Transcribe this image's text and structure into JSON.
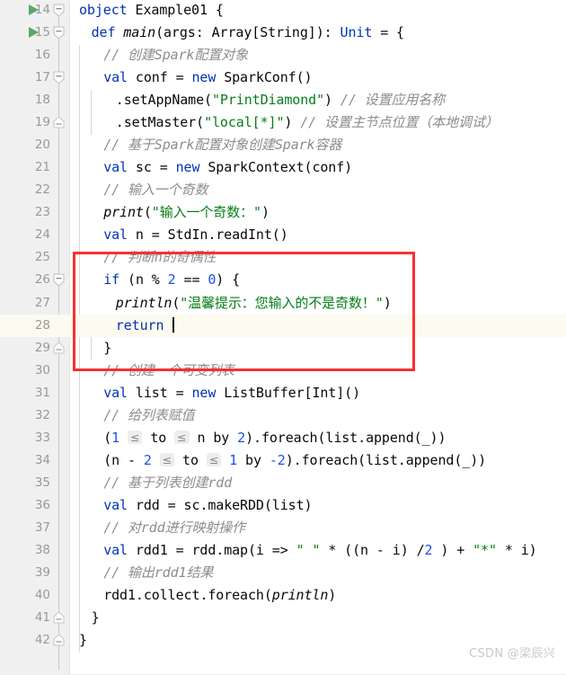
{
  "app": {
    "name": "IntelliJ IDEA Scala Editor",
    "watermark": "CSDN @梁辰兴",
    "colors": {
      "keyword": "#0033b3",
      "number": "#1750eb",
      "string": "#067d17",
      "comment": "#8c8c8c",
      "gutter_bg": "#f0f0f0",
      "current_line_bg": "#fdfaf0",
      "annotation_box": "#f93030",
      "run_arrow": "#59a869"
    }
  },
  "editor": {
    "first_line_number": 14,
    "current_line_number": 28,
    "annotation_box": {
      "type": "red-rectangle-highlight",
      "covers_lines": "25-29",
      "color": "#f93030"
    },
    "lines": [
      {
        "n": 14,
        "indent": 0,
        "run_arrow": true,
        "fold": "open",
        "text": "object Example01 {"
      },
      {
        "n": 15,
        "indent": 1,
        "run_arrow": true,
        "fold": "open",
        "text": "def main(args: Array[String]): Unit = {"
      },
      {
        "n": 16,
        "indent": 2,
        "run_arrow": false,
        "fold": "none",
        "text": "// 创建Spark配置对象"
      },
      {
        "n": 17,
        "indent": 2,
        "run_arrow": false,
        "fold": "open",
        "text": "val conf = new SparkConf()"
      },
      {
        "n": 18,
        "indent": 3,
        "run_arrow": false,
        "fold": "none",
        "text": ".setAppName(\"PrintDiamond\") // 设置应用名称"
      },
      {
        "n": 19,
        "indent": 3,
        "run_arrow": false,
        "fold": "close",
        "text": ".setMaster(\"local[*]\") // 设置主节点位置（本地调试）"
      },
      {
        "n": 20,
        "indent": 2,
        "run_arrow": false,
        "fold": "none",
        "text": "// 基于Spark配置对象创建Spark容器"
      },
      {
        "n": 21,
        "indent": 2,
        "run_arrow": false,
        "fold": "none",
        "text": "val sc = new SparkContext(conf)"
      },
      {
        "n": 22,
        "indent": 2,
        "run_arrow": false,
        "fold": "none",
        "text": "// 输入一个奇数"
      },
      {
        "n": 23,
        "indent": 2,
        "run_arrow": false,
        "fold": "none",
        "text": "print(\"输入一个奇数：\")"
      },
      {
        "n": 24,
        "indent": 2,
        "run_arrow": false,
        "fold": "none",
        "text": "val n = StdIn.readInt()"
      },
      {
        "n": 25,
        "indent": 2,
        "run_arrow": false,
        "fold": "none",
        "text": "// 判断n的奇偶性"
      },
      {
        "n": 26,
        "indent": 2,
        "run_arrow": false,
        "fold": "open",
        "text": "if (n % 2 == 0) {"
      },
      {
        "n": 27,
        "indent": 3,
        "run_arrow": false,
        "fold": "none",
        "text": "println(\"温馨提示：您输入的不是奇数！\")"
      },
      {
        "n": 28,
        "indent": 3,
        "run_arrow": false,
        "fold": "none",
        "text": "return ",
        "caret": true,
        "current": true
      },
      {
        "n": 29,
        "indent": 2,
        "run_arrow": false,
        "fold": "close",
        "text": "}"
      },
      {
        "n": 30,
        "indent": 2,
        "run_arrow": false,
        "fold": "none",
        "text": "// 创建一个可变列表"
      },
      {
        "n": 31,
        "indent": 2,
        "run_arrow": false,
        "fold": "none",
        "text": "val list = new ListBuffer[Int]()"
      },
      {
        "n": 32,
        "indent": 2,
        "run_arrow": false,
        "fold": "none",
        "text": "// 给列表赋值"
      },
      {
        "n": 33,
        "indent": 2,
        "run_arrow": false,
        "fold": "none",
        "text": "(1 ≤ to ≤ n by 2).foreach(list.append(_))",
        "hints": [
          "≤",
          "≤"
        ]
      },
      {
        "n": 34,
        "indent": 2,
        "run_arrow": false,
        "fold": "none",
        "text": "(n - 2 ≤ to ≤ 1 by -2).foreach(list.append(_))",
        "hints": [
          "≤",
          "≤"
        ]
      },
      {
        "n": 35,
        "indent": 2,
        "run_arrow": false,
        "fold": "none",
        "text": "// 基于列表创建rdd"
      },
      {
        "n": 36,
        "indent": 2,
        "run_arrow": false,
        "fold": "none",
        "text": "val rdd = sc.makeRDD(list)"
      },
      {
        "n": 37,
        "indent": 2,
        "run_arrow": false,
        "fold": "none",
        "text": "// 对rdd进行映射操作"
      },
      {
        "n": 38,
        "indent": 2,
        "run_arrow": false,
        "fold": "none",
        "text": "val rdd1 = rdd.map(i => \" \" * ((n - i) /2 ) + \"*\" * i)"
      },
      {
        "n": 39,
        "indent": 2,
        "run_arrow": false,
        "fold": "none",
        "text": "// 输出rdd1结果"
      },
      {
        "n": 40,
        "indent": 2,
        "run_arrow": false,
        "fold": "none",
        "text": "rdd1.collect.foreach(println)"
      },
      {
        "n": 41,
        "indent": 1,
        "run_arrow": false,
        "fold": "close",
        "text": "}"
      },
      {
        "n": 42,
        "indent": 0,
        "run_arrow": false,
        "fold": "close",
        "text": "}"
      }
    ]
  }
}
